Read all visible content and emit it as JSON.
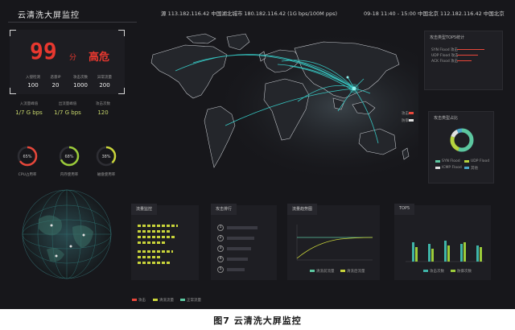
{
  "header": {
    "title": "云清洗大屏监控",
    "tickers": [
      "源 113.182.116.42 中国湖北城市 180.182.116.42 (1G bps/100M pps)",
      "09-18 11:40 - 15:00 中国北京 112.182.116.42 中国北京"
    ]
  },
  "score": {
    "value": "99",
    "unit": "分",
    "level": "高危",
    "stats": [
      {
        "label": "入侵检测",
        "value": "100"
      },
      {
        "label": "恶意IP",
        "value": "20"
      },
      {
        "label": "攻击次数",
        "value": "1000"
      },
      {
        "label": "异常流量",
        "value": "200"
      }
    ]
  },
  "mini_stats": [
    {
      "label": "入流量峰值",
      "value": "1/7 G bps"
    },
    {
      "label": "出流量峰值",
      "value": "1/7 G bps"
    },
    {
      "label": "攻击次数",
      "value": "120"
    }
  ],
  "gauges": [
    {
      "label": "CPU占用率",
      "value": "65%",
      "fraction": 0.65,
      "color": "#e8473a"
    },
    {
      "label": "内存使用率",
      "value": "68%",
      "fraction": 0.68,
      "color": "#9ccc3a"
    },
    {
      "label": "磁盘使用率",
      "value": "38%",
      "fraction": 0.38,
      "color": "#c9d43a"
    }
  ],
  "right_panels": {
    "top": {
      "title": "攻击类型TOP5统计",
      "lines": [
        "SYN Flood 攻击",
        "UDP Flood 攻击",
        "ACK Flood 攻击"
      ]
    },
    "legend": [
      "攻击",
      "防御"
    ],
    "donut": {
      "title": "攻击类型占比",
      "segments": [
        {
          "label": "SYN Flood",
          "fraction": 0.55,
          "color": "#5cc7a0"
        },
        {
          "label": "UDP Flood",
          "fraction": 0.25,
          "color": "#b6d43e"
        },
        {
          "label": "ICMP Flood",
          "fraction": 0.12,
          "color": "#e0e0e0"
        },
        {
          "label": "其他",
          "fraction": 0.08,
          "color": "#4aa7c9"
        }
      ],
      "legend": [
        "SYN Flood",
        "UDP Flood",
        "ICMP Flood",
        "其他"
      ]
    }
  },
  "bottom_panels": [
    {
      "tab": "流量监控"
    },
    {
      "tab": "攻击排行",
      "items": [
        "1",
        "2",
        "3",
        "4",
        "5"
      ]
    },
    {
      "tab": "流量趋势图",
      "legend": [
        "清洗前流量",
        "清洗后流量"
      ]
    },
    {
      "tab": "TOP5",
      "legend": [
        "攻击次数",
        "防御次数"
      ]
    }
  ],
  "footer_legend": [
    "攻击",
    "清洗流量",
    "正常流量"
  ],
  "caption": "图7  云清洗大屏监控"
}
